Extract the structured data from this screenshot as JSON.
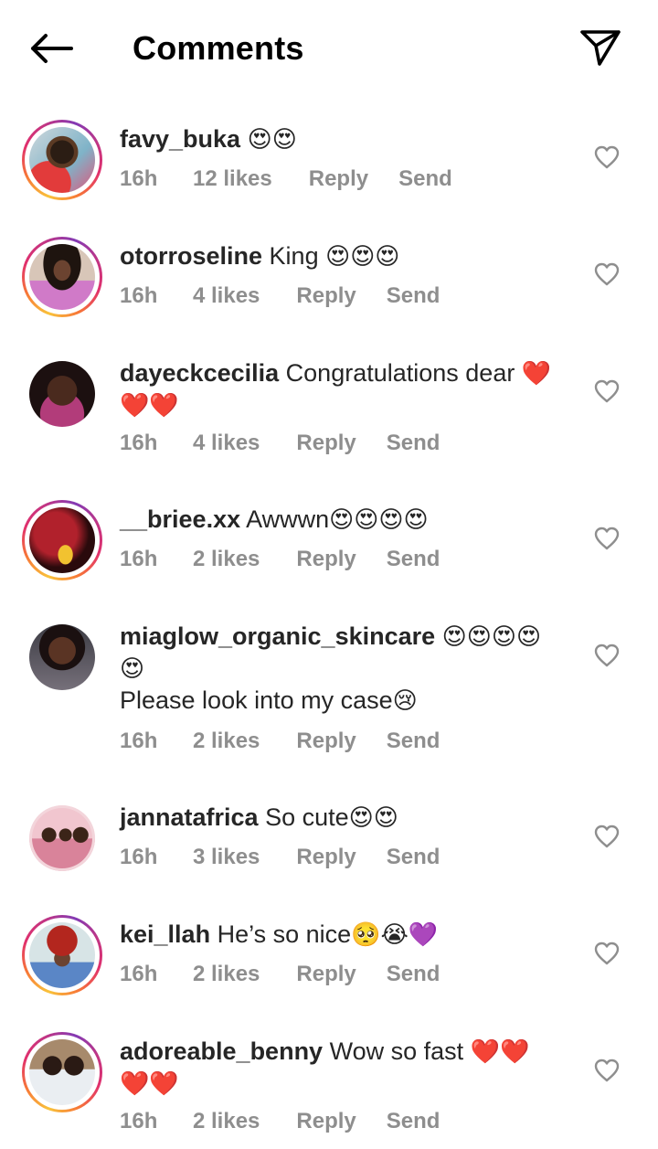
{
  "header": {
    "title": "Comments",
    "back_icon": "arrow-left-icon",
    "send_icon": "paper-plane-icon"
  },
  "colors": {
    "text": "#262626",
    "meta": "#8e8e8e",
    "heart_outline": "#8e8e8e",
    "story_ring": [
      "#f9c33b",
      "#f77737",
      "#e1306c",
      "#c13584",
      "#833ab4"
    ]
  },
  "comments": [
    {
      "username": "favy_buka",
      "text": "",
      "emoji_after": "😍😍",
      "time": "16h",
      "likes": "12 likes",
      "reply": "Reply",
      "send": "Send",
      "story_ring": true
    },
    {
      "username": "otorroseline",
      "text": "King ",
      "emoji_after": "😍😍😍",
      "time": "16h",
      "likes": "4 likes",
      "reply": "Reply",
      "send": "Send",
      "story_ring": true
    },
    {
      "username": "dayeckcecilia",
      "text": "Congratulations dear ",
      "emoji_after": "❤️❤️❤️",
      "time": "16h",
      "likes": "4 likes",
      "reply": "Reply",
      "send": "Send",
      "story_ring": false
    },
    {
      "username": "__briee.xx",
      "text": "Awwwn",
      "emoji_after": "😍😍😍😍",
      "time": "16h",
      "likes": "2 likes",
      "reply": "Reply",
      "send": "Send",
      "story_ring": true
    },
    {
      "username": "miaglow_organic_skincare",
      "text": "",
      "emoji_after": "😍😍😍😍😍",
      "text2": "Please look into my case",
      "emoji_after2": "😢",
      "time": "16h",
      "likes": "2 likes",
      "reply": "Reply",
      "send": "Send",
      "story_ring": false
    },
    {
      "username": "jannatafrica",
      "text": "So cute",
      "emoji_after": "😍😍",
      "time": "16h",
      "likes": "3 likes",
      "reply": "Reply",
      "send": "Send",
      "story_ring": false
    },
    {
      "username": "kei_llah",
      "text": "He’s so nice",
      "emoji_after": "🥺😭💜",
      "time": "16h",
      "likes": "2 likes",
      "reply": "Reply",
      "send": "Send",
      "story_ring": true
    },
    {
      "username": "adoreable_benny",
      "text": "Wow so fast ",
      "emoji_after": "❤️❤️❤️❤️",
      "time": "16h",
      "likes": "2 likes",
      "reply": "Reply",
      "send": "Send",
      "story_ring": true
    }
  ]
}
